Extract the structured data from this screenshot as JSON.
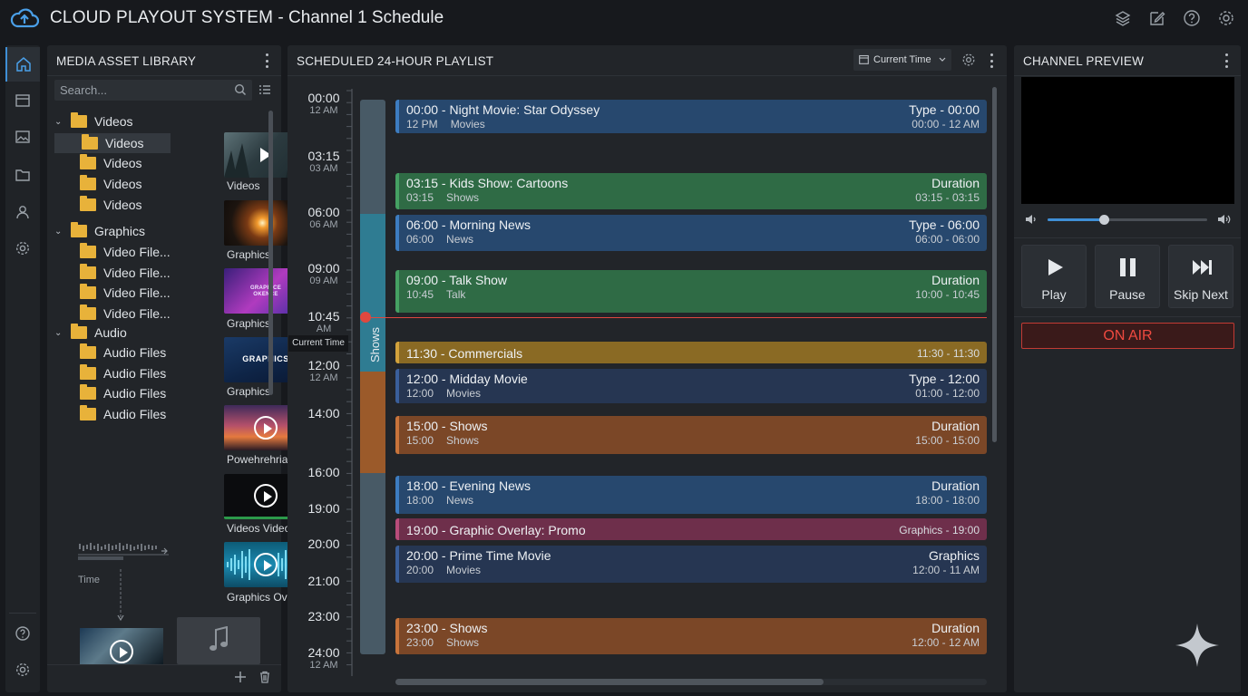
{
  "app": {
    "brand": "CLOUD PLAYOUT SYSTEM",
    "separator": " - ",
    "subtitle": "Channel 1 Schedule"
  },
  "top_icons": [
    "layers-icon",
    "edit-icon",
    "help-icon",
    "settings-icon"
  ],
  "rail": {
    "items": [
      "home-icon",
      "playlist-icon",
      "image-icon",
      "folder-icon",
      "user-icon",
      "gear-icon"
    ],
    "bottom": [
      "help-icon",
      "settings-icon"
    ]
  },
  "library": {
    "title": "MEDIA ASSET LIBRARY",
    "search_placeholder": "Search...",
    "tree": [
      {
        "label": "Videos",
        "kind": "group"
      },
      {
        "label": "Videos",
        "kind": "child",
        "selected": true
      },
      {
        "label": "Videos",
        "kind": "child"
      },
      {
        "label": "Videos",
        "kind": "child"
      },
      {
        "label": "Videos",
        "kind": "child"
      },
      {
        "label": "Graphics",
        "kind": "group"
      },
      {
        "label": "Video File...",
        "kind": "child"
      },
      {
        "label": "Video File...",
        "kind": "child"
      },
      {
        "label": "Video File...",
        "kind": "child"
      },
      {
        "label": "Video File...",
        "kind": "child"
      },
      {
        "label": "Audio",
        "kind": "group"
      },
      {
        "label": "Audio Files",
        "kind": "child"
      },
      {
        "label": "Audio Files",
        "kind": "child"
      },
      {
        "label": "Audio Files",
        "kind": "child"
      },
      {
        "label": "Audio Files",
        "kind": "child"
      }
    ],
    "thumbnails": [
      {
        "caption": "Videos"
      },
      {
        "caption": "Graphics"
      },
      {
        "caption": "Graphics",
        "overlay_text": "GRAPHICE OKENCE"
      },
      {
        "caption": "Graphics",
        "overlay_text": "GRAPHICS"
      },
      {
        "caption": "Powehrehriar..."
      },
      {
        "caption": "Videos Video"
      },
      {
        "caption": "Graphics Over..."
      }
    ],
    "timeline_label": "Time"
  },
  "playlist": {
    "title": "SCHEDULED 24-HOUR PLAYLIST",
    "time_select": "Current Time",
    "current_time_label": "Current Time",
    "track_label": "Shows",
    "times": [
      {
        "h": "00:00",
        "s": "12 AM"
      },
      {
        "h": "03:15",
        "s": "03 AM"
      },
      {
        "h": "06:00",
        "s": "06 AM"
      },
      {
        "h": "09:00",
        "s": "09 AM"
      },
      {
        "h": "10:45",
        "s": "AM"
      },
      {
        "h": "12:00",
        "s": "12 AM"
      },
      {
        "h": "14:00",
        "s": ""
      },
      {
        "h": "16:00",
        "s": ""
      },
      {
        "h": "19:00",
        "s": ""
      },
      {
        "h": "20:00",
        "s": ""
      },
      {
        "h": "21:00",
        "s": ""
      },
      {
        "h": "23:00",
        "s": ""
      },
      {
        "h": "24:00",
        "s": "12 AM"
      }
    ],
    "events": [
      {
        "title": "00:00 - Night Movie: Star Odyssey",
        "start": "12 PM",
        "category": "Movies",
        "right_top": "Type - 00:00",
        "right_bottom": "00:00 - 12 AM",
        "color": "blue"
      },
      {
        "title": "03:15 - Kids Show: Cartoons",
        "start": "03:15",
        "category": "Shows",
        "right_top": "Duration",
        "right_bottom": "03:15 - 03:15",
        "color": "green"
      },
      {
        "title": "06:00 - Morning News",
        "start": "06:00",
        "category": "News",
        "right_top": "Type - 06:00",
        "right_bottom": "06:00 - 06:00",
        "color": "blue"
      },
      {
        "title": "09:00 - Talk Show",
        "start": "10:45",
        "category": "Talk",
        "right_top": "Duration",
        "right_bottom": "10:00 - 10:45",
        "color": "green"
      },
      {
        "title": "11:30 - Commercials",
        "right_top": "11:30 - 11:30",
        "color": "gold"
      },
      {
        "title": "12:00 - Midday Movie",
        "start": "12:00",
        "category": "Movies",
        "right_top": "Type - 12:00",
        "right_bottom": "01:00 - 12:00",
        "color": "navy"
      },
      {
        "title": "15:00 - Shows",
        "start": "15:00",
        "category": "Shows",
        "right_top": "Duration",
        "right_bottom": "15:00 - 15:00",
        "color": "orange"
      },
      {
        "title": "18:00 - Evening News",
        "start": "18:00",
        "category": "News",
        "right_top": "Duration",
        "right_bottom": "18:00 - 18:00",
        "color": "blue"
      },
      {
        "title": "19:00 - Graphic Overlay: Promo",
        "right_top": "Graphics - 19:00",
        "color": "pink"
      },
      {
        "title": "20:00 - Prime Time Movie",
        "start": "20:00",
        "category": "Movies",
        "right_top": "Graphics",
        "right_bottom": "12:00 - 11 AM",
        "color": "navy"
      },
      {
        "title": "23:00 - Shows",
        "start": "23:00",
        "category": "Shows",
        "right_top": "Duration",
        "right_bottom": "12:00 - 12 AM",
        "color": "orange"
      }
    ]
  },
  "preview": {
    "title": "CHANNEL PREVIEW",
    "volume": 0.35,
    "buttons": [
      {
        "label": "Play",
        "icon": "play-icon"
      },
      {
        "label": "Pause",
        "icon": "pause-icon"
      },
      {
        "label": "Skip Next",
        "icon": "skip-next-icon"
      }
    ],
    "on_air": "ON AIR"
  },
  "colors": {
    "accent": "#3f8fd6",
    "on_air": "#e0483f",
    "playhead": "#e0483f"
  }
}
